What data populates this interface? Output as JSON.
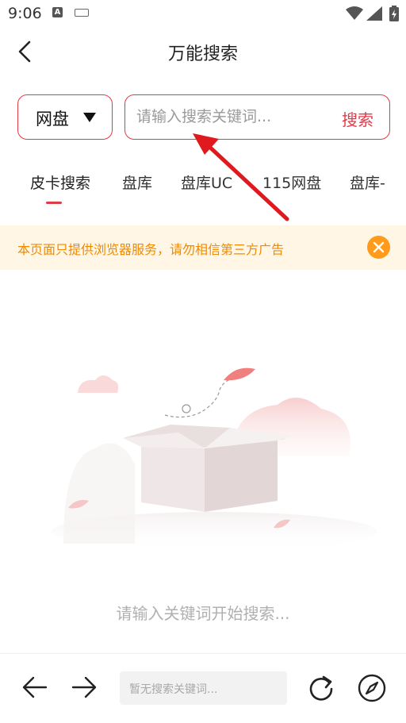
{
  "status_bar": {
    "time": "9:06",
    "icons": [
      "accessibility-icon",
      "keyboard-icon",
      "wifi-icon",
      "signal-icon",
      "battery-icon"
    ]
  },
  "header": {
    "title": "万能搜索",
    "back_icon": "chevron-left-icon"
  },
  "search": {
    "type_selected": "网盘",
    "placeholder": "请输入搜索关键词...",
    "button_label": "搜索"
  },
  "tabs": [
    {
      "label": "皮卡搜索",
      "active": true
    },
    {
      "label": "盘库",
      "active": false
    },
    {
      "label": "盘库UC",
      "active": false
    },
    {
      "label": "115网盘",
      "active": false
    },
    {
      "label": "盘库-",
      "active": false
    }
  ],
  "notice": {
    "text": "本页面只提供浏览器服务，请勿相信第三方广告",
    "close_icon": "close-icon"
  },
  "empty_state": {
    "illustration": "empty-box-illustration",
    "text": "请输入关键词开始搜索..."
  },
  "bottom_bar": {
    "url_placeholder": "暂无搜索关键词...",
    "icons": [
      "arrow-left-icon",
      "arrow-right-icon",
      "reload-icon",
      "compass-icon"
    ]
  },
  "colors": {
    "accent": "#e23a46",
    "notice_bg": "#fff6e6",
    "notice_text": "#f08a00",
    "notice_close": "#ff9a1a"
  }
}
